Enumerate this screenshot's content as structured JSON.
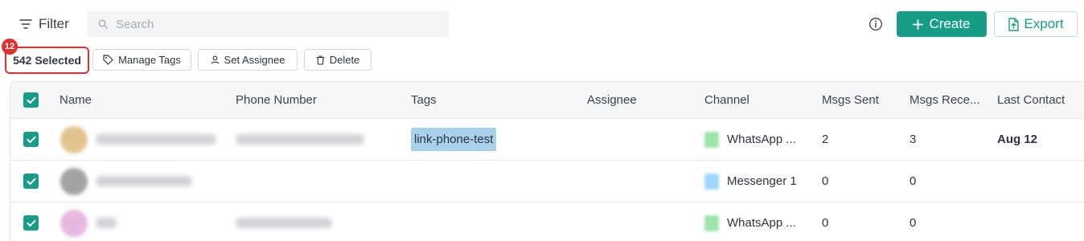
{
  "toolbar": {
    "filter_label": "Filter",
    "search_placeholder": "Search",
    "create_label": "Create",
    "export_label": "Export"
  },
  "selection": {
    "badge_count": "12",
    "selected_label": "542 Selected",
    "actions": {
      "manage_tags": "Manage Tags",
      "set_assignee": "Set Assignee",
      "delete": "Delete"
    }
  },
  "table": {
    "columns": {
      "name": "Name",
      "phone": "Phone Number",
      "tags": "Tags",
      "assignee": "Assignee",
      "channel": "Channel",
      "msgs_sent": "Msgs Sent",
      "msgs_received": "Msgs Rece...",
      "last_contact": "Last Contact"
    },
    "rows": [
      {
        "tag": "link-phone-test",
        "channel": "WhatsApp ...",
        "msgs_sent": "2",
        "msgs_received": "3",
        "last_contact": "Aug 12"
      },
      {
        "tag": "",
        "channel": "Messenger 1",
        "msgs_sent": "0",
        "msgs_received": "0",
        "last_contact": ""
      },
      {
        "tag": "",
        "channel": "WhatsApp ...",
        "msgs_sent": "0",
        "msgs_received": "0",
        "last_contact": ""
      }
    ]
  },
  "colors": {
    "accent": "#179c86",
    "selection_highlight": "#e03131",
    "tag_background": "#a8d1ec",
    "whatsapp_icon": "#9ee3a8",
    "messenger_icon": "#9fd8fb"
  },
  "icons": {
    "filter": "filter-lines-icon",
    "search": "magnifier-icon",
    "info": "info-circle-icon",
    "create": "plus-icon",
    "export": "file-export-icon",
    "manage_tags": "tag-icon",
    "set_assignee": "user-icon",
    "delete": "trash-icon",
    "checkbox": "check-icon"
  }
}
